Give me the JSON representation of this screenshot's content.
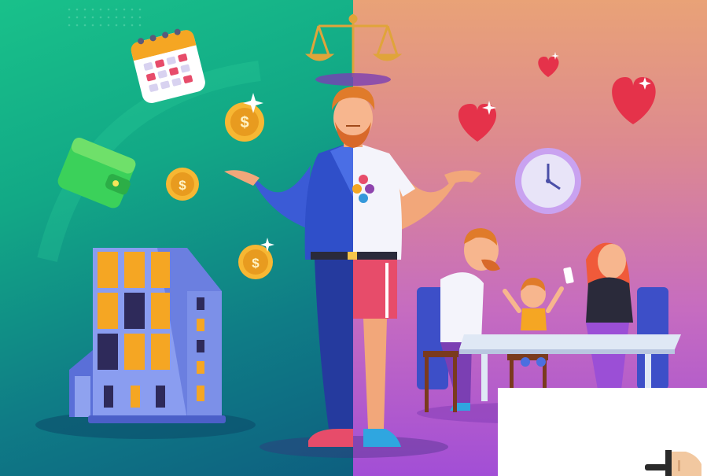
{
  "illustration": {
    "theme": "work-life-balance",
    "left_side": [
      "calendar-icon",
      "wallet-icon",
      "coin-icon",
      "office-building"
    ],
    "right_side": [
      "heart-icon",
      "clock-icon",
      "family-at-table"
    ],
    "center": [
      "balance-scale-icon",
      "split-man"
    ]
  },
  "coin_symbol": "$",
  "colors": {
    "left_gradient_top": "#19c18a",
    "left_gradient_bottom": "#0d5f80",
    "right_gradient_top": "#e9a277",
    "right_gradient_bottom": "#a24ed6",
    "coin": "#f7b733",
    "heart": "#e5324a",
    "building_window": "#f5a623"
  }
}
